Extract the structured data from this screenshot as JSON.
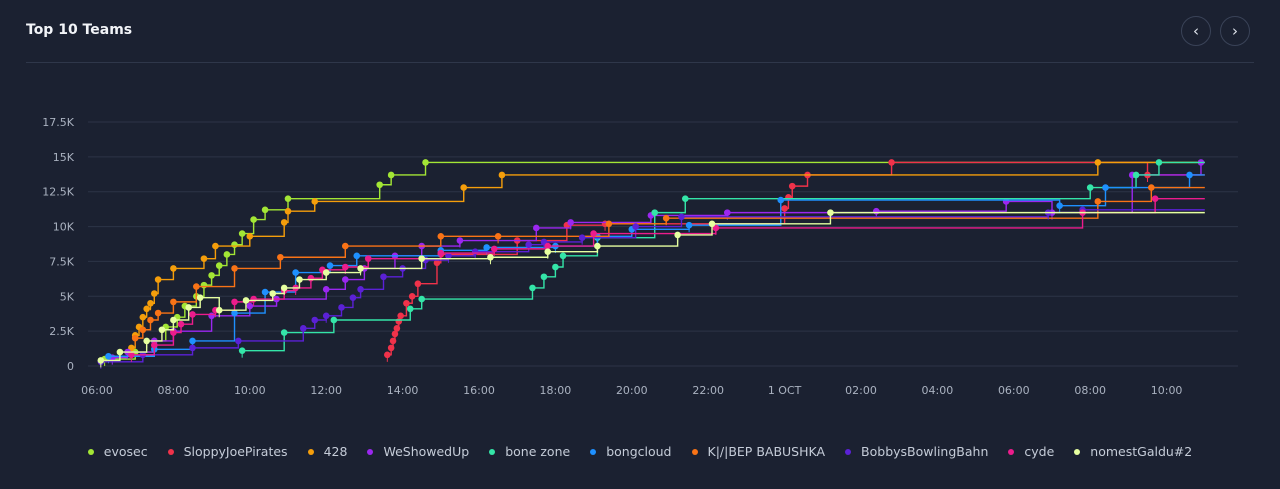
{
  "header": {
    "title": "Top 10 Teams",
    "prev_label": "‹",
    "next_label": "›",
    "prev_icon": "chevron-left-icon",
    "next_icon": "chevron-right-icon"
  },
  "chart_data": {
    "type": "line",
    "step": true,
    "title": "",
    "xlabel": "",
    "ylabel": "",
    "x_unit": "hours since 06:00 on day before 1 OCT",
    "x_ticks": [
      {
        "x": 0,
        "label": "06:00"
      },
      {
        "x": 2,
        "label": "08:00"
      },
      {
        "x": 4,
        "label": "10:00"
      },
      {
        "x": 6,
        "label": "12:00"
      },
      {
        "x": 8,
        "label": "14:00"
      },
      {
        "x": 10,
        "label": "16:00"
      },
      {
        "x": 12,
        "label": "18:00"
      },
      {
        "x": 14,
        "label": "20:00"
      },
      {
        "x": 16,
        "label": "22:00"
      },
      {
        "x": 18,
        "label": "1 OCT"
      },
      {
        "x": 20,
        "label": "02:00"
      },
      {
        "x": 22,
        "label": "04:00"
      },
      {
        "x": 24,
        "label": "06:00"
      },
      {
        "x": 26,
        "label": "08:00"
      },
      {
        "x": 28,
        "label": "10:00"
      }
    ],
    "y_ticks": [
      {
        "y": 0,
        "label": "0"
      },
      {
        "y": 2500,
        "label": "2.5K"
      },
      {
        "y": 5000,
        "label": "5K"
      },
      {
        "y": 7500,
        "label": "7.5K"
      },
      {
        "y": 10000,
        "label": "10K"
      },
      {
        "y": 12500,
        "label": "12.5K"
      },
      {
        "y": 15000,
        "label": "15K"
      },
      {
        "y": 17500,
        "label": "17.5K"
      }
    ],
    "xlim": [
      0,
      30
    ],
    "ylim": [
      0,
      17500
    ],
    "grid": true,
    "legend_position": "bottom",
    "series": [
      {
        "name": "evosec",
        "color": "#a3e635",
        "points": [
          [
            0.2,
            500
          ],
          [
            1.0,
            1000
          ],
          [
            1.5,
            1800
          ],
          [
            1.8,
            2800
          ],
          [
            2.1,
            3500
          ],
          [
            2.3,
            4300
          ],
          [
            2.6,
            5000
          ],
          [
            2.8,
            5800
          ],
          [
            3.0,
            6500
          ],
          [
            3.2,
            7200
          ],
          [
            3.4,
            8000
          ],
          [
            3.6,
            8700
          ],
          [
            3.8,
            9500
          ],
          [
            4.1,
            10500
          ],
          [
            4.4,
            11200
          ],
          [
            5.0,
            12000
          ],
          [
            7.4,
            13000
          ],
          [
            7.7,
            13700
          ],
          [
            8.6,
            14600
          ]
        ]
      },
      {
        "name": "SloppyJoePirates",
        "color": "#f0324a",
        "points": [
          [
            7.6,
            800
          ],
          [
            7.7,
            1300
          ],
          [
            7.75,
            1800
          ],
          [
            7.8,
            2300
          ],
          [
            7.85,
            2700
          ],
          [
            7.9,
            3200
          ],
          [
            7.95,
            3600
          ],
          [
            8.1,
            4500
          ],
          [
            8.25,
            5000
          ],
          [
            8.4,
            5900
          ],
          [
            8.9,
            7400
          ],
          [
            9.0,
            8000
          ],
          [
            11.0,
            9000
          ],
          [
            12.3,
            10100
          ],
          [
            13.3,
            10200
          ],
          [
            18.0,
            11300
          ],
          [
            18.1,
            12100
          ],
          [
            18.2,
            12900
          ],
          [
            18.6,
            13700
          ],
          [
            20.8,
            14600
          ],
          [
            27.5,
            13700
          ]
        ]
      },
      {
        "name": "428",
        "color": "#f59e0b",
        "points": [
          [
            0.9,
            1300
          ],
          [
            1.0,
            2200
          ],
          [
            1.1,
            2800
          ],
          [
            1.2,
            3500
          ],
          [
            1.3,
            4100
          ],
          [
            1.4,
            4500
          ],
          [
            1.5,
            5200
          ],
          [
            1.6,
            6200
          ],
          [
            2.0,
            7000
          ],
          [
            2.8,
            7700
          ],
          [
            3.1,
            8600
          ],
          [
            4.0,
            9300
          ],
          [
            4.9,
            10300
          ],
          [
            5.0,
            11100
          ],
          [
            5.7,
            11800
          ],
          [
            9.6,
            12800
          ],
          [
            10.6,
            13700
          ],
          [
            26.2,
            14600
          ]
        ]
      },
      {
        "name": "WeShowedUp",
        "color": "#9b27f0",
        "points": [
          [
            0.4,
            600
          ],
          [
            0.8,
            1000
          ],
          [
            1.5,
            1800
          ],
          [
            2.0,
            2500
          ],
          [
            3.0,
            3600
          ],
          [
            4.0,
            4300
          ],
          [
            4.7,
            4800
          ],
          [
            6.0,
            5500
          ],
          [
            6.5,
            6200
          ],
          [
            7.0,
            7000
          ],
          [
            7.8,
            7900
          ],
          [
            8.5,
            8600
          ],
          [
            9.5,
            9000
          ],
          [
            11.5,
            9900
          ],
          [
            12.4,
            10300
          ],
          [
            14.5,
            10800
          ],
          [
            16.5,
            11000
          ],
          [
            20.4,
            11100
          ],
          [
            23.8,
            11800
          ],
          [
            25.0,
            11000
          ],
          [
            27.1,
            13700
          ],
          [
            28.9,
            14600
          ]
        ]
      },
      {
        "name": "bone zone",
        "color": "#34e5a8",
        "points": [
          [
            3.8,
            1100
          ],
          [
            4.9,
            2400
          ],
          [
            6.2,
            3300
          ],
          [
            8.2,
            4100
          ],
          [
            8.5,
            4800
          ],
          [
            11.4,
            5600
          ],
          [
            11.7,
            6400
          ],
          [
            12.0,
            7100
          ],
          [
            12.2,
            7900
          ],
          [
            13.1,
            9200
          ],
          [
            14.6,
            11000
          ],
          [
            15.4,
            12000
          ],
          [
            26.0,
            12800
          ],
          [
            27.2,
            13700
          ],
          [
            27.8,
            14600
          ]
        ]
      },
      {
        "name": "bongcloud",
        "color": "#1e90ff",
        "points": [
          [
            0.3,
            700
          ],
          [
            1.5,
            1200
          ],
          [
            2.5,
            1800
          ],
          [
            3.6,
            3800
          ],
          [
            4.4,
            5300
          ],
          [
            5.2,
            6700
          ],
          [
            6.1,
            7200
          ],
          [
            6.8,
            7900
          ],
          [
            9.0,
            8300
          ],
          [
            10.2,
            8500
          ],
          [
            12.0,
            8600
          ],
          [
            13.1,
            9300
          ],
          [
            14.0,
            9800
          ],
          [
            15.5,
            10100
          ],
          [
            17.9,
            11900
          ],
          [
            25.2,
            11500
          ],
          [
            26.4,
            12800
          ],
          [
            28.6,
            13700
          ]
        ]
      },
      {
        "name": "K|/|BEP BABUSHKA",
        "color": "#f97316",
        "points": [
          [
            1.0,
            2000
          ],
          [
            1.2,
            2600
          ],
          [
            1.4,
            3300
          ],
          [
            1.6,
            3800
          ],
          [
            2.0,
            4600
          ],
          [
            2.6,
            5700
          ],
          [
            3.6,
            7000
          ],
          [
            4.8,
            7800
          ],
          [
            6.5,
            8600
          ],
          [
            9.0,
            9300
          ],
          [
            10.5,
            9300
          ],
          [
            13.4,
            10200
          ],
          [
            14.9,
            10600
          ],
          [
            26.2,
            11800
          ],
          [
            27.6,
            12800
          ]
        ]
      },
      {
        "name": "BobbysBowlingBahn",
        "color": "#5b21d6",
        "points": [
          [
            0.1,
            300
          ],
          [
            1.2,
            800
          ],
          [
            2.5,
            1300
          ],
          [
            3.7,
            1800
          ],
          [
            5.4,
            2700
          ],
          [
            5.7,
            3300
          ],
          [
            6.0,
            3600
          ],
          [
            6.4,
            4200
          ],
          [
            6.7,
            4900
          ],
          [
            6.9,
            5500
          ],
          [
            7.5,
            6400
          ],
          [
            8.0,
            7000
          ],
          [
            8.6,
            7600
          ],
          [
            9.2,
            7900
          ],
          [
            9.9,
            8200
          ],
          [
            11.3,
            8700
          ],
          [
            11.7,
            8900
          ],
          [
            12.7,
            9200
          ],
          [
            14.1,
            10000
          ],
          [
            15.3,
            10700
          ],
          [
            24.9,
            11000
          ],
          [
            25.8,
            11200
          ]
        ]
      },
      {
        "name": "cyde",
        "color": "#ec1c8c",
        "points": [
          [
            0.9,
            800
          ],
          [
            1.5,
            1500
          ],
          [
            2.0,
            2400
          ],
          [
            2.2,
            3000
          ],
          [
            2.5,
            3700
          ],
          [
            3.1,
            4000
          ],
          [
            3.6,
            4600
          ],
          [
            4.1,
            4800
          ],
          [
            4.9,
            5400
          ],
          [
            5.2,
            5600
          ],
          [
            5.6,
            6300
          ],
          [
            5.9,
            6900
          ],
          [
            6.5,
            7100
          ],
          [
            7.1,
            7700
          ],
          [
            9.0,
            8100
          ],
          [
            10.4,
            8400
          ],
          [
            11.8,
            8600
          ],
          [
            13.0,
            9500
          ],
          [
            16.2,
            9900
          ],
          [
            25.8,
            11000
          ],
          [
            27.7,
            12000
          ]
        ]
      },
      {
        "name": "nomestGaldu#2",
        "color": "#e6ffa0",
        "points": [
          [
            0.1,
            400
          ],
          [
            0.6,
            1000
          ],
          [
            1.3,
            1800
          ],
          [
            1.7,
            2600
          ],
          [
            2.0,
            3300
          ],
          [
            2.4,
            4200
          ],
          [
            2.7,
            4900
          ],
          [
            3.2,
            4000
          ],
          [
            3.9,
            4700
          ],
          [
            4.6,
            5200
          ],
          [
            4.9,
            5600
          ],
          [
            5.3,
            6200
          ],
          [
            6.0,
            6700
          ],
          [
            6.9,
            7000
          ],
          [
            8.5,
            7700
          ],
          [
            10.3,
            7800
          ],
          [
            11.8,
            8200
          ],
          [
            13.1,
            8600
          ],
          [
            15.2,
            9400
          ],
          [
            16.1,
            10200
          ],
          [
            19.2,
            11000
          ]
        ]
      }
    ]
  }
}
